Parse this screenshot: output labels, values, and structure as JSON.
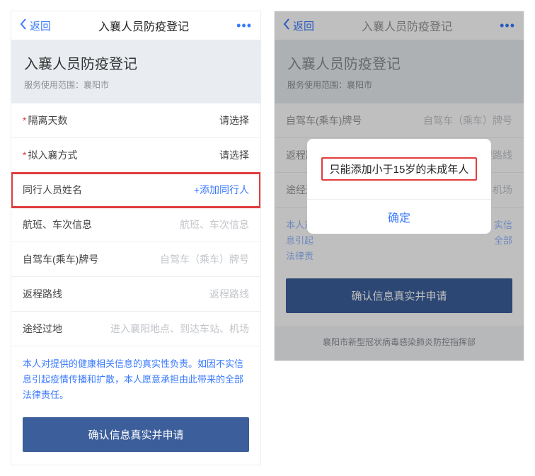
{
  "nav": {
    "back": "返回",
    "title": "入襄人员防疫登记",
    "more": "•••"
  },
  "header": {
    "title": "入襄人员防疫登记",
    "scope_label": "服务使用范围：",
    "scope_value": "襄阳市"
  },
  "left": {
    "rows": {
      "quarantine": {
        "label": "隔离天数",
        "value": "请选择"
      },
      "method": {
        "label": "拟入襄方式",
        "value": "请选择"
      },
      "companion": {
        "label": "同行人员姓名",
        "action": "+添加同行人"
      },
      "flight": {
        "label": "航班、车次信息",
        "placeholder": "航班、车次信息"
      },
      "car": {
        "label": "自驾车(乘车)牌号",
        "placeholder": "自驾车（乘车）牌号"
      },
      "route": {
        "label": "返程路线",
        "placeholder": "返程路线"
      },
      "via": {
        "label": "途经过地",
        "placeholder": "进入襄阳地点、到达车站、机场"
      }
    },
    "notice": "本人对提供的健康相关信息的真实性负责。如因不实信息引起疫情传播和扩散，本人愿意承担由此带来的全部法律责任。",
    "confirm": "确认信息真实并申请"
  },
  "right": {
    "rows": {
      "car": {
        "label": "自驾车(乘车)牌号",
        "placeholder": "自驾车（乘车）牌号"
      },
      "route": {
        "label": "返程路线",
        "placeholder": "返程路线"
      },
      "via": {
        "label": "途经过",
        "placeholder": "机场"
      },
      "companion_short": {
        "label": "本人对"
      }
    },
    "notice_partial_1": "息引起",
    "notice_partial_2": "法律责",
    "notice_suffix_1": "实信",
    "notice_suffix_2": "全部",
    "confirm": "确认信息真实并申请",
    "source": "襄阳市新型冠状病毒感染肺炎防控指挥部",
    "dialog": {
      "message": "只能添加小于15岁的未成年人",
      "ok": "确定"
    }
  }
}
